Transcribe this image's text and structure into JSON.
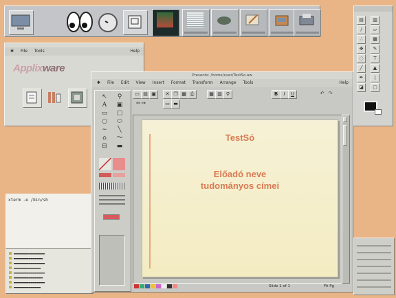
{
  "colors": {
    "desktop": "#e9b486",
    "slide_text": "#d97a52",
    "slide_bg": "#f4eec8"
  },
  "top_panel": {
    "icons": [
      "monitor-icon",
      "eyes-icon",
      "clock-icon",
      "calendar-icon"
    ],
    "tray": [
      "terminal-icon",
      "document-icon",
      "network-icon",
      "paint-icon",
      "folder-icon",
      "printer-icon"
    ]
  },
  "applix": {
    "menu": {
      "file": "File",
      "tools": "Tools",
      "help": "Help"
    },
    "logo_main": "Applix",
    "logo_tail": "ware"
  },
  "shell": {
    "command": "xterm -e /bin/sh"
  },
  "mail": {
    "rows": 9
  },
  "presents": {
    "title": "Presents: /home/user/TestSo.aw",
    "menu": {
      "file": "File",
      "edit": "Edit",
      "view": "View",
      "insert": "Insert",
      "format": "Format",
      "transform": "Transform",
      "arrange": "Arrange",
      "tools": "Tools",
      "help": "Help"
    },
    "toolbar": {
      "bold": "B",
      "italic": "I",
      "underline": "U",
      "undo": "↶",
      "redo": "↷",
      "arrows": "↤ ↦"
    },
    "slide": {
      "title": "TestSó",
      "body_line1": "Előadó neve",
      "body_line2": "tudományos címei"
    },
    "status": {
      "page": "Slide 1 of 1",
      "zoom": "Fit Pg"
    }
  },
  "draw_palette": {
    "tools": [
      "Fill",
      "Line"
    ]
  }
}
